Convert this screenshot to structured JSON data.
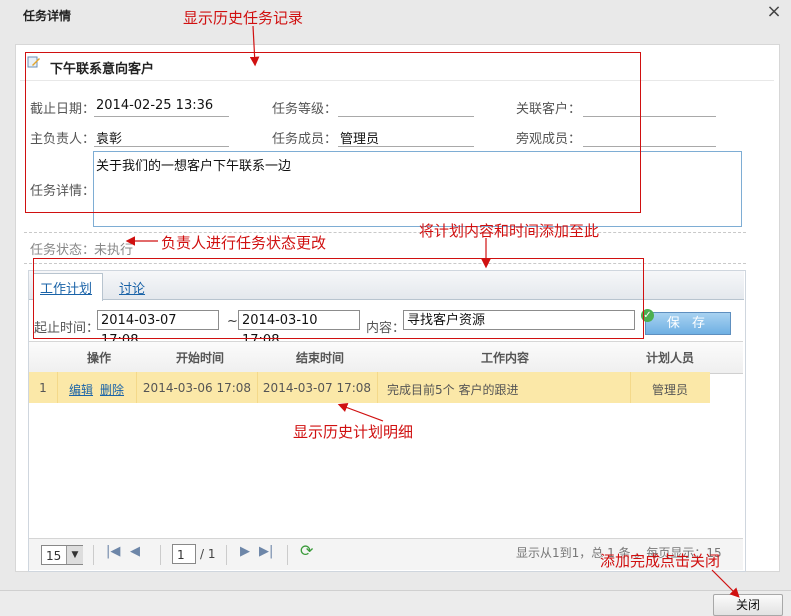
{
  "dialog": {
    "title": "任务详情",
    "close_icon": "×",
    "close_button": "关闭"
  },
  "task": {
    "name": "下午联系意向客户",
    "deadline_label": "截止日期：",
    "deadline_value": "2014-02-25 13:36",
    "level_label": "任务等级：",
    "level_value": "",
    "customer_label": "关联客户：",
    "customer_value": "",
    "owner_label": "主负责人：",
    "owner_value": "袁彰",
    "members_label": "任务成员：",
    "members_value": "管理员",
    "observers_label": "旁观成员：",
    "observers_value": "",
    "detail_label": "任务详情：",
    "detail_value": "关于我们的一想客户下午联系一边",
    "status_label": "任务状态：",
    "status_value": "未执行"
  },
  "tabs": [
    {
      "label": "工作计划",
      "active": true
    },
    {
      "label": "讨论",
      "active": false
    }
  ],
  "plan_form": {
    "time_label": "起止时间：",
    "start_value": "2014-03-07 17:08",
    "range_separator": "~",
    "end_value": "2014-03-10 17:08",
    "content_label": "内容：",
    "content_value": "寻找客户资源",
    "save_label": "保 存"
  },
  "grid": {
    "columns": [
      "操作",
      "开始时间",
      "结束时间",
      "工作内容",
      "计划人员"
    ],
    "rows": [
      {
        "index": "1",
        "edit": "编辑",
        "delete": "删除",
        "start": "2014-03-06 17:08",
        "end": "2014-03-07 17:08",
        "content": "完成目前5个 客户的跟进",
        "person": "管理员"
      }
    ]
  },
  "pager": {
    "page_size": "15",
    "page": "1",
    "total_pages": "/ 1",
    "info": "显示从1到1，总 1 条 。每页显示：15"
  },
  "annotations": {
    "history_task": "显示历史任务记录",
    "status_change": "负责人进行任务状态更改",
    "add_plan": "将计划内容和时间添加至此",
    "history_plan": "显示历史计划明细",
    "close_hint": "添加完成点击关闭",
    "color": "#d01010"
  }
}
